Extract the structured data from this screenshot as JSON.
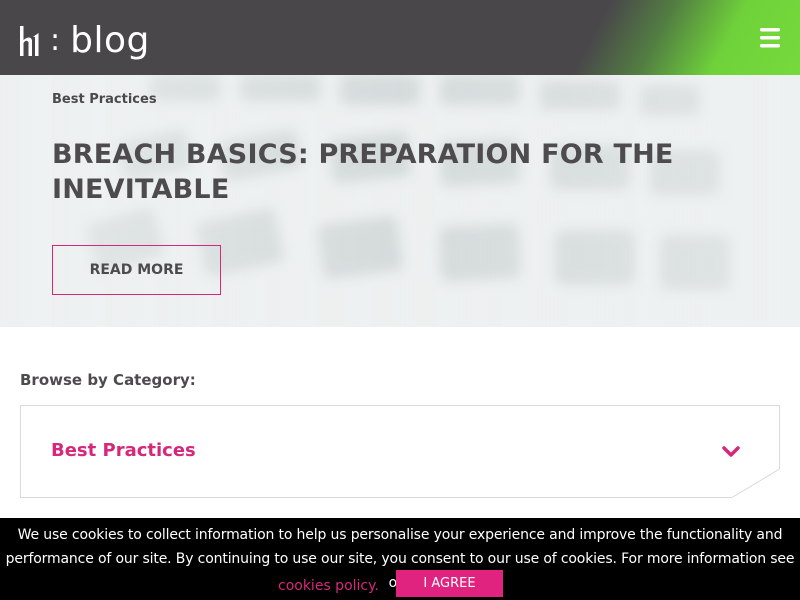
{
  "header": {
    "logo_separator": ":",
    "logo_text": "blog",
    "logo_icon": "h1-logo-icon",
    "menu_icon": "hamburger-menu-icon",
    "colors": {
      "background": "#49474a",
      "accent": "#7ee23f"
    }
  },
  "hero": {
    "category": "Best Practices",
    "title": "BREACH BASICS: PREPARATION FOR THE INEVITABLE",
    "read_more_label": "READ MORE"
  },
  "browse": {
    "label": "Browse by Category:",
    "selected_category": "Best Practices",
    "dropdown_icon": "chevron-down-icon"
  },
  "cookie_bar": {
    "message": "We use cookies to collect information to help us personalise your experience and improve the functionality and performance of our site. By continuing to use our site, you consent to our use of cookies. For more information see our",
    "policy_link": "cookies policy.",
    "agree_label": "I AGREE"
  },
  "colors": {
    "brand_pink": "#d6287a",
    "text_dark": "#4d4b4e"
  }
}
